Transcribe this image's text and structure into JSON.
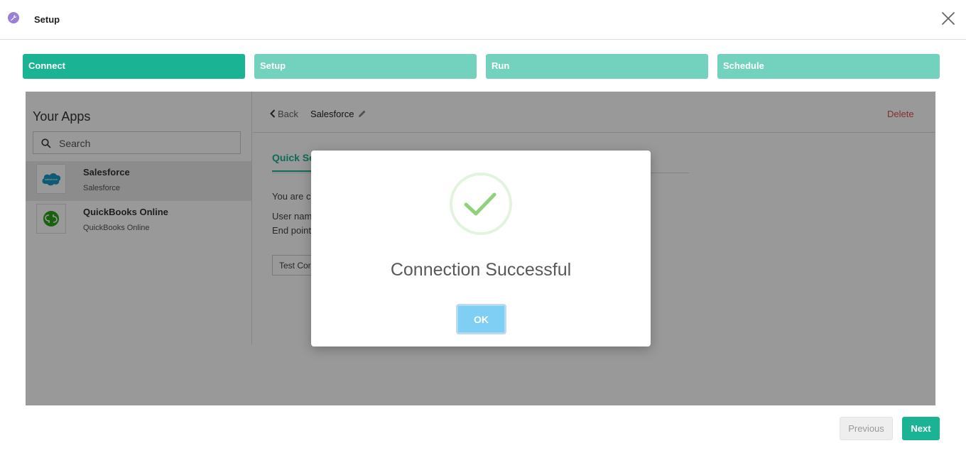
{
  "header": {
    "title": "Setup",
    "app_icon": "wrench-icon",
    "close_icon": "close-icon"
  },
  "steps": [
    {
      "label": "Connect",
      "state": "active"
    },
    {
      "label": "Setup",
      "state": "inactive"
    },
    {
      "label": "Run",
      "state": "inactive"
    },
    {
      "label": "Schedule",
      "state": "inactive"
    }
  ],
  "apps_panel": {
    "heading": "Your Apps",
    "search_placeholder": "Search",
    "items": [
      {
        "name": "Salesforce",
        "subtitle": "Salesforce",
        "logo": "salesforce-logo",
        "selected": true
      },
      {
        "name": "QuickBooks Online",
        "subtitle": "QuickBooks Online",
        "logo": "quickbooks-logo",
        "selected": false
      }
    ]
  },
  "detail": {
    "back_label": "Back",
    "app_title": "Salesforce",
    "delete_label": "Delete",
    "tab_label": "Quick Se",
    "info_line_1": "You are cu",
    "info_line_2": "User nam",
    "info_line_3": "End point",
    "test_button_label": "Test Cor"
  },
  "modal": {
    "icon": "checkmark-icon",
    "title": "Connection Successful",
    "ok_label": "OK"
  },
  "footer": {
    "previous_label": "Previous",
    "next_label": "Next"
  },
  "colors": {
    "accent": "#1ab394",
    "accent_light": "#72d2bd",
    "danger": "#d9534f",
    "ok_button": "#7fcff5",
    "check": "#8fd27a"
  }
}
